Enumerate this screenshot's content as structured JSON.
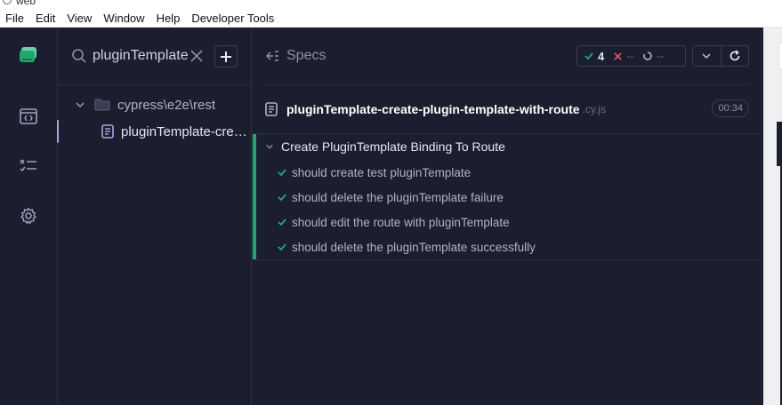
{
  "window": {
    "title": "web"
  },
  "menubar": {
    "items": [
      "File",
      "Edit",
      "View",
      "Window",
      "Help",
      "Developer Tools"
    ]
  },
  "colors": {
    "pass": "#1fa971",
    "fail": "#e45770",
    "accent": "#a6a9d8",
    "background": "#1b1e2e"
  },
  "nav": {
    "items": [
      {
        "icon": "specs-browser-icon"
      },
      {
        "icon": "runs-list-icon"
      },
      {
        "icon": "settings-gear-icon"
      }
    ]
  },
  "speclist": {
    "search": {
      "value": "pluginTemplate"
    },
    "tree": {
      "folder": "cypress\\e2e\\rest",
      "file": "pluginTemplate-create-plugin-template-with-route.cy.js"
    }
  },
  "main": {
    "header": "Specs",
    "stats": {
      "passed": "4",
      "failed": "--",
      "pending": "--"
    },
    "spec": {
      "name": "pluginTemplate-create-plugin-template-with-route",
      "ext": ".cy.js",
      "duration": "00:34"
    },
    "suite": {
      "title": "Create PluginTemplate Binding To Route",
      "tests": [
        "should create test pluginTemplate",
        "should delete the pluginTemplate failure",
        "should edit the route with pluginTemplate",
        "should delete the pluginTemplate successfully"
      ]
    }
  }
}
